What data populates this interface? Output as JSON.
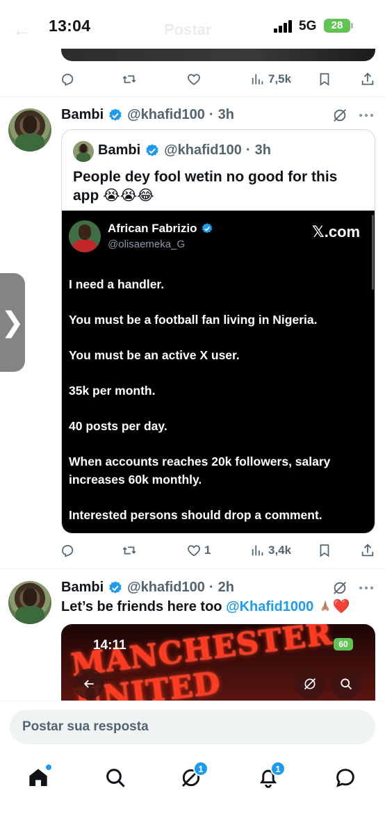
{
  "status_bar": {
    "time": "13:04",
    "network": "5G",
    "battery": "28",
    "ghost_title": "Postar"
  },
  "post1_actions": {
    "views": "7,5k"
  },
  "post2": {
    "author": "Bambi",
    "handle": "@khafid100",
    "time": "3h",
    "quote": {
      "author": "Bambi",
      "handle": "@khafid100",
      "time": "3h",
      "text": "People dey fool wetin no good for this app 😭😭😂",
      "screenshot": {
        "author": "African Fabrizio",
        "handle": "@olisaemeka_G",
        "brand": "𝕏.com",
        "lines": [
          "I need a handler.",
          "You must be a football fan living in Nigeria.",
          "You must be an active X user.",
          "35k per month.",
          "40 posts per day.",
          "When accounts reaches 20k followers, salary increases 60k monthly.",
          "Interested persons should drop a comment."
        ]
      }
    },
    "actions": {
      "likes": "1",
      "views": "3,4k"
    }
  },
  "post3": {
    "author": "Bambi",
    "handle": "@khafid100",
    "time": "2h",
    "text_prefix": "Let’s be friends here too ",
    "mention": "@Khafid1000",
    "emoji_suffix": "❤️",
    "media": {
      "time": "14:11",
      "sign_text": "MANCHESTER UNITED",
      "battery": "60"
    }
  },
  "reply": {
    "placeholder": "Postar sua resposta"
  },
  "bottom_nav": {
    "grok_badge": "1",
    "notifications_badge": "1"
  },
  "colors": {
    "accent": "#1d9bf0",
    "muted": "#536471",
    "battery": "#61c353"
  }
}
